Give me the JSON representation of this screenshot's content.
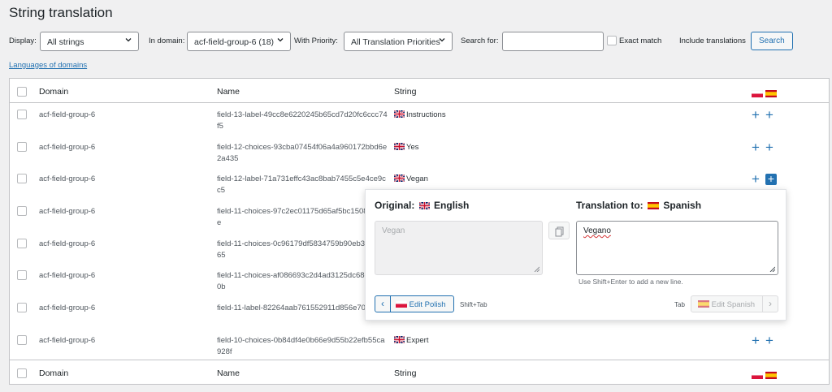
{
  "page": {
    "title": "String translation"
  },
  "filters": {
    "display_label": "Display:",
    "display_value": "All strings",
    "domain_label": "In domain:",
    "domain_value": "acf-field-group-6 (18)",
    "priority_label": "With Priority:",
    "priority_value": "All Translation Priorities",
    "search_label": "Search for:",
    "search_value": "",
    "exact_match_label": "Exact match",
    "include_translations_label": "Include translations",
    "search_button": "Search"
  },
  "languages_link": "Languages of domains",
  "table": {
    "headers": {
      "domain": "Domain",
      "name": "Name",
      "string": "String"
    },
    "rows": [
      {
        "domain": "acf-field-group-6",
        "name": "field-13-label-49cc8e6220245b65cd7d20fc6ccc74f5",
        "string": "Instructions"
      },
      {
        "domain": "acf-field-group-6",
        "name": "field-12-choices-93cba07454f06a4a960172bbd6e2a435",
        "string": "Yes"
      },
      {
        "domain": "acf-field-group-6",
        "name": "field-12-label-71a731effc43ac8bab7455c5e4ce9cc5",
        "string": "Vegan"
      },
      {
        "domain": "acf-field-group-6",
        "name": "field-11-choices-97c2ec01175d65af5bc15\n0870bbe",
        "string": ""
      },
      {
        "domain": "acf-field-group-6",
        "name": "field-11-choices-0c96179df5834759b90e\nb3834a365",
        "string": ""
      },
      {
        "domain": "acf-field-group-6",
        "name": "field-11-choices-af086693c2d4ad3125dc\n68c68d00b",
        "string": ""
      },
      {
        "domain": "acf-field-group-6",
        "name": "field-11-label-82264aab761552911d856e\n70a780",
        "string": ""
      },
      {
        "domain": "acf-field-group-6",
        "name": "field-10-choices-0b84df4e0b66e9d55b22efb55ca928f",
        "string": "Expert"
      }
    ]
  },
  "editor": {
    "original_label": "Original:",
    "original_lang": "English",
    "translation_label": "Translation to:",
    "translation_lang": "Spanish",
    "original_text": "Vegan",
    "translation_text": "Vegano",
    "hint": "Use Shift+Enter to add a new line.",
    "prev_button": "Edit Polish",
    "prev_shortcut": "Shift+Tab",
    "next_shortcut": "Tab",
    "next_button": "Edit Spanish"
  },
  "colors": {
    "accent": "#2271b1",
    "background": "#f0f0f1",
    "border": "#c3c4c7"
  },
  "icons": [
    "chevron-down-icon",
    "flag-uk-icon",
    "flag-pl-icon",
    "flag-es-icon",
    "plus-icon",
    "copy-icon",
    "chevron-left-icon",
    "chevron-right-icon",
    "resize-grip-icon"
  ]
}
